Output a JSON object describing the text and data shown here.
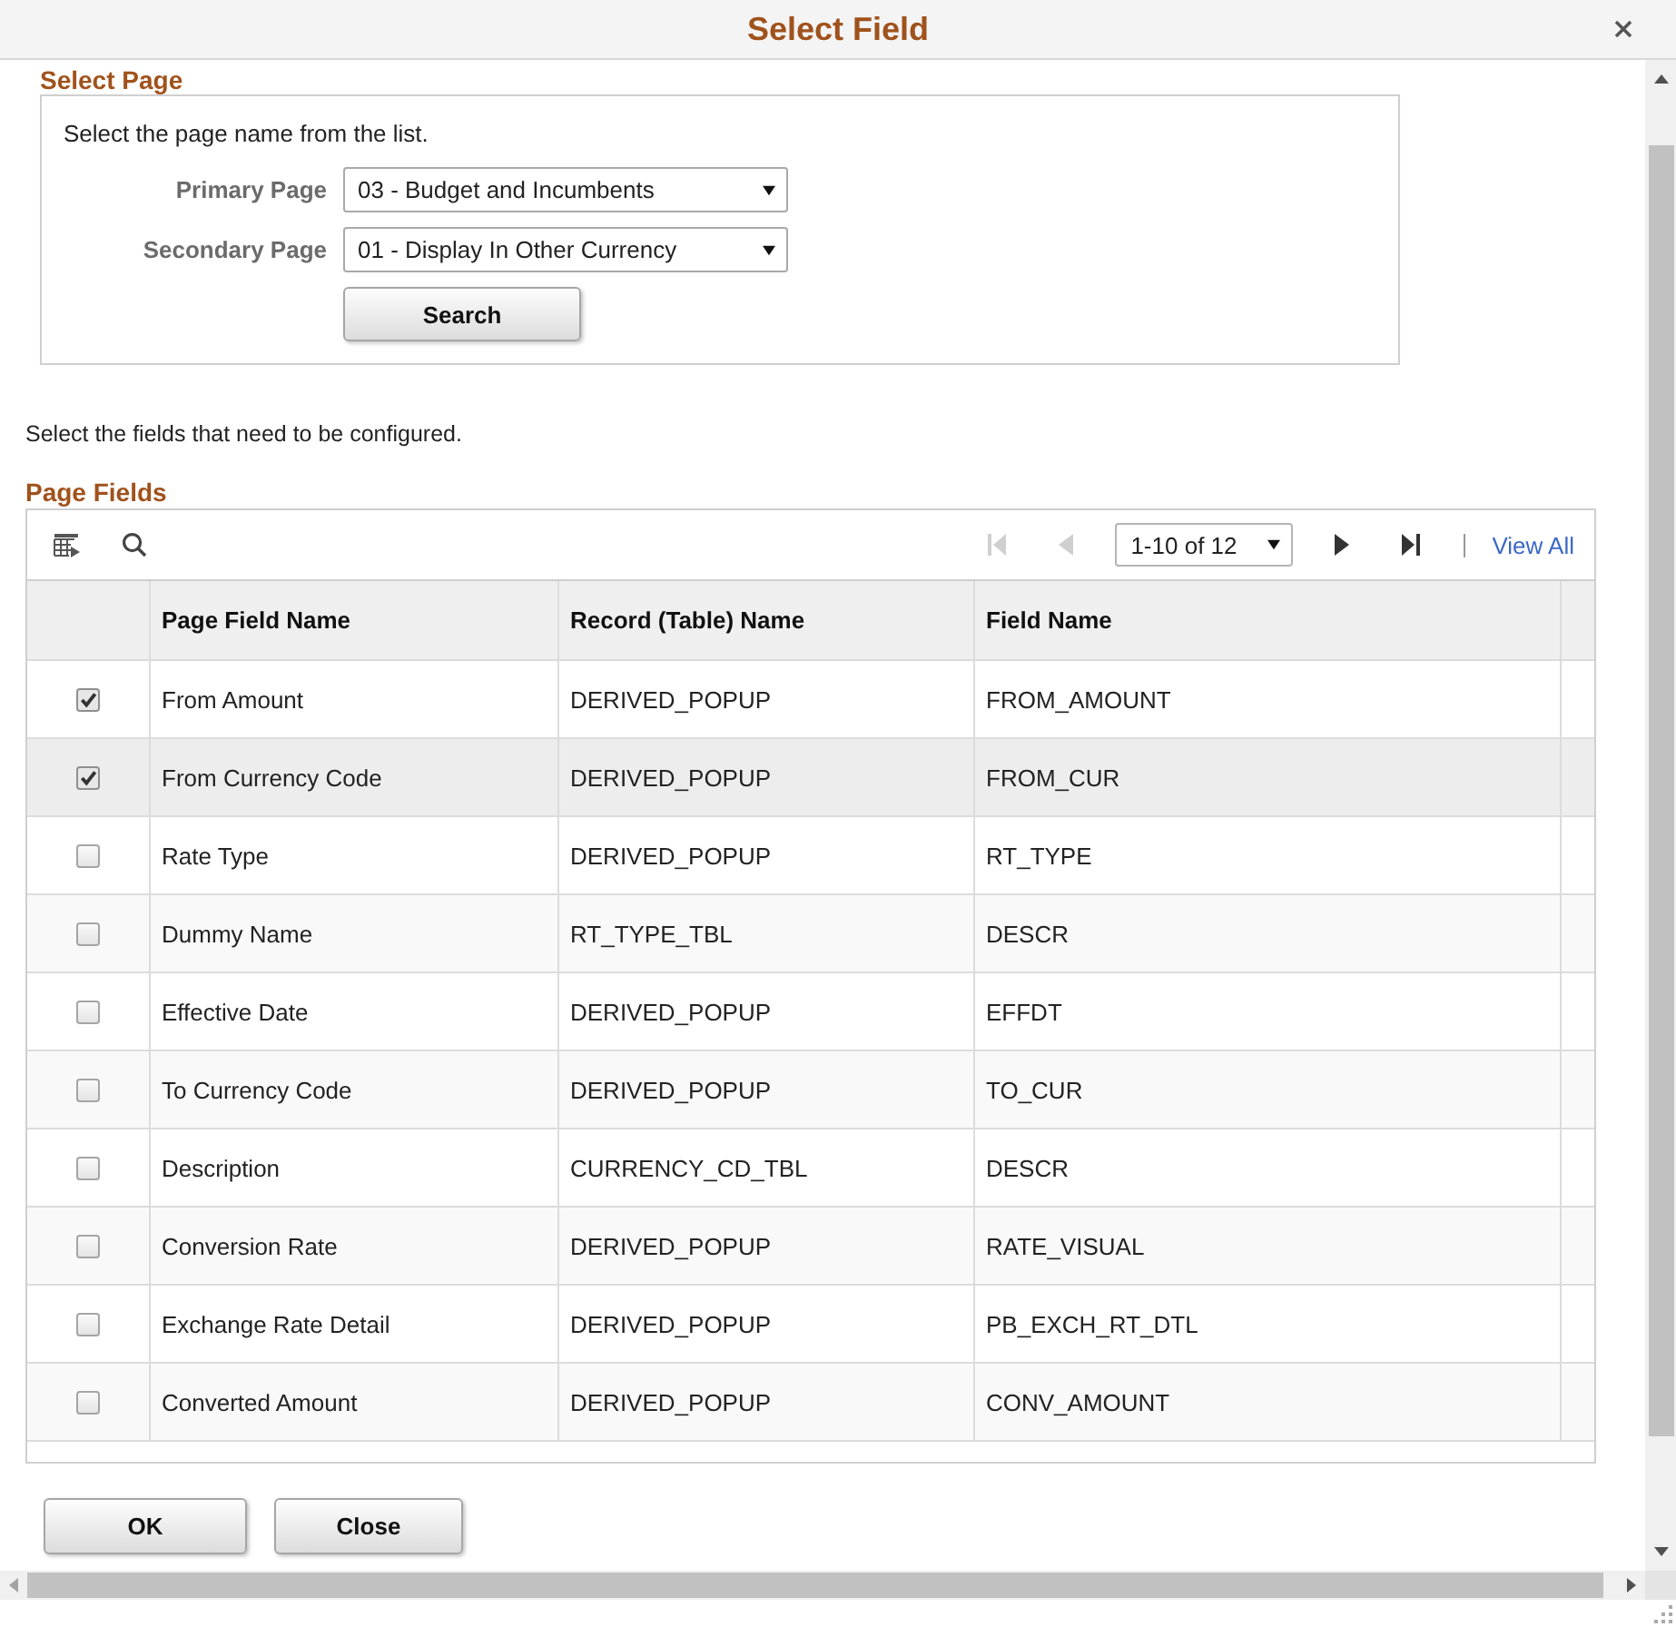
{
  "window": {
    "title": "Select Field"
  },
  "select_page": {
    "heading": "Select Page",
    "instruction": "Select the page name from the list.",
    "fields": [
      {
        "label": "Primary Page",
        "value": "03 - Budget and Incumbents"
      },
      {
        "label": "Secondary Page",
        "value": "01 - Display In Other Currency"
      }
    ],
    "button": "Search"
  },
  "instruction": "Select the fields that need to be configured.",
  "page_fields": {
    "heading": "Page Fields",
    "pager": {
      "nav_before": [
        {
          "kind": "first",
          "disabled": true
        },
        {
          "kind": "prev",
          "disabled": true
        }
      ],
      "range": "1-10 of 12",
      "nav_after": [
        {
          "kind": "next",
          "disabled": false
        },
        {
          "kind": "last",
          "disabled": false
        }
      ],
      "view_all": "View All"
    },
    "columns": [
      "Page Field Name",
      "Record (Table) Name",
      "Field Name"
    ],
    "rows": [
      {
        "checked": true,
        "highlighted": false,
        "cells": [
          "From Amount",
          "DERIVED_POPUP",
          "FROM_AMOUNT"
        ]
      },
      {
        "checked": true,
        "highlighted": true,
        "cells": [
          "From Currency Code",
          "DERIVED_POPUP",
          "FROM_CUR"
        ]
      },
      {
        "checked": false,
        "highlighted": false,
        "cells": [
          "Rate Type",
          "DERIVED_POPUP",
          "RT_TYPE"
        ]
      },
      {
        "checked": false,
        "highlighted": false,
        "cells": [
          "Dummy Name",
          "RT_TYPE_TBL",
          "DESCR"
        ]
      },
      {
        "checked": false,
        "highlighted": false,
        "cells": [
          "Effective Date",
          "DERIVED_POPUP",
          "EFFDT"
        ]
      },
      {
        "checked": false,
        "highlighted": false,
        "cells": [
          "To Currency Code",
          "DERIVED_POPUP",
          "TO_CUR"
        ]
      },
      {
        "checked": false,
        "highlighted": false,
        "cells": [
          "Description",
          "CURRENCY_CD_TBL",
          "DESCR"
        ]
      },
      {
        "checked": false,
        "highlighted": false,
        "cells": [
          "Conversion Rate",
          "DERIVED_POPUP",
          "RATE_VISUAL"
        ]
      },
      {
        "checked": false,
        "highlighted": false,
        "cells": [
          "Exchange Rate Detail",
          "DERIVED_POPUP",
          "PB_EXCH_RT_DTL"
        ]
      },
      {
        "checked": false,
        "highlighted": false,
        "cells": [
          "Converted Amount",
          "DERIVED_POPUP",
          "CONV_AMOUNT"
        ]
      }
    ]
  },
  "buttons": [
    {
      "kind": "ok",
      "label": "OK"
    },
    {
      "kind": "close",
      "label": "Close"
    }
  ]
}
